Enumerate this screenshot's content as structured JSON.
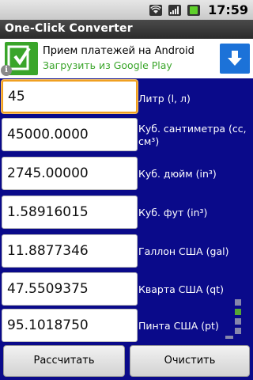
{
  "status": {
    "time": "17:59",
    "icons": [
      "wifi-icon",
      "signal-icon",
      "battery-icon"
    ]
  },
  "app": {
    "title": "One-Click Converter"
  },
  "ad": {
    "title": "Прием платежей на Android",
    "subtitle": "Загрузить из Google Play",
    "info": "i",
    "colors": {
      "logo": "#3aa52a",
      "download": "#1c72d8"
    }
  },
  "rows": [
    {
      "value": "45",
      "unit": "Литр (l, л)"
    },
    {
      "value": "45000.0000",
      "unit_line1": "Куб. сантиметра (cc,",
      "unit_line2": "см³)"
    },
    {
      "value": "2745.00000",
      "unit": "Куб. дюйм (in³)"
    },
    {
      "value": "1.58916015",
      "unit": "Куб. фут (in³)"
    },
    {
      "value": "11.8877346",
      "unit": "Галлон США (gal)"
    },
    {
      "value": "47.5509375",
      "unit": "Кварта США (qt)"
    },
    {
      "value": "95.1018750",
      "unit": "Пинта США (pt)"
    }
  ],
  "buttons": {
    "calculate": "Рассчитать",
    "clear": "Очистить"
  },
  "colors": {
    "background": "#0a0a8a",
    "focus": "#f0a020"
  }
}
